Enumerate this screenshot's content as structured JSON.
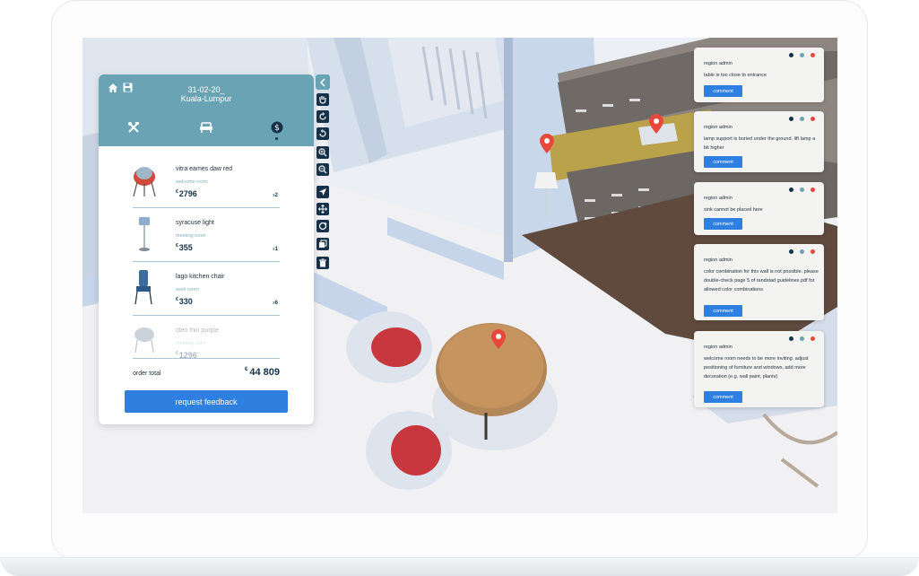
{
  "header": {
    "date": "31-02-20_",
    "location": "Kuala-Lumpur",
    "icons": [
      "home-icon",
      "save-icon"
    ],
    "tabs": [
      "tools-icon",
      "furniture-icon",
      "budget-icon"
    ]
  },
  "order": {
    "items": [
      {
        "name": "vitra eames daw red",
        "room": "welcome room",
        "currency": "€",
        "price": "2796",
        "qty": "2",
        "qty_prefix": "x"
      },
      {
        "name": "syracuse light",
        "room": "meeting room",
        "currency": "€",
        "price": "355",
        "qty": "1",
        "qty_prefix": "x"
      },
      {
        "name": "lago kitchen chair",
        "room": "work room",
        "currency": "€",
        "price": "330",
        "qty": "6",
        "qty_prefix": "x"
      },
      {
        "name": "oleo thin purple",
        "room": "meeting room",
        "currency": "€",
        "price": "1296",
        "qty": "",
        "qty_prefix": ""
      }
    ],
    "total_label": "order total",
    "total_currency": "€",
    "total_value": "44 809",
    "feedback_button": "request feedback"
  },
  "toolbar": {
    "tools": [
      "collapse-icon",
      "hand-icon",
      "rotate-left-icon",
      "rotate-right-icon",
      "zoom-in-icon",
      "zoom-out-icon",
      "pointer-icon",
      "move-icon",
      "rotate-icon",
      "copy-icon",
      "trash-icon"
    ]
  },
  "comments": [
    {
      "author": "region admin",
      "text": "table is too close to entrance",
      "button": "comment"
    },
    {
      "author": "region admin",
      "text": "lamp support is buried under the ground. lift lamp a bit higher",
      "button": "comment"
    },
    {
      "author": "region admin",
      "text": "sink cannot be placed here",
      "button": "comment"
    },
    {
      "author": "region admin",
      "text": "color combination for this wall is not possible. please double-check page 5 of randstad guidelines pdf for allowed color combinations",
      "button": "comment"
    },
    {
      "author": "region admin",
      "text": "welcome room needs to be more inviting. adjust positioning of furniture and windows, add more decoration (e.g. wall paint, plants)",
      "button": "comment"
    }
  ],
  "colors": {
    "accent": "#2f7fe0",
    "header": "#6aa3b4",
    "dark": "#16324a",
    "pin": "#e8483a"
  }
}
